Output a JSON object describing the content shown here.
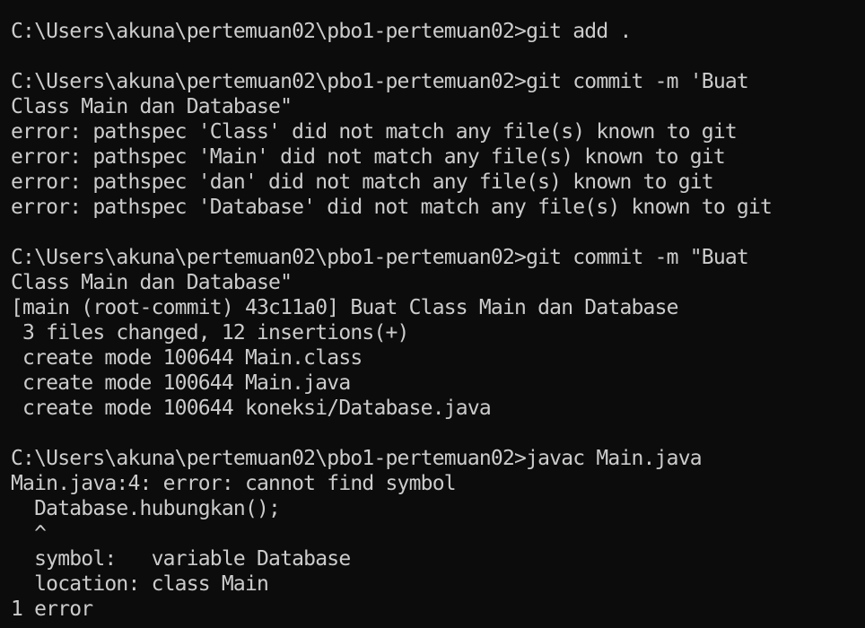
{
  "terminal": {
    "lines": [
      "C:\\Users\\akuna\\pertemuan02\\pbo1-pertemuan02>git add .",
      "",
      "C:\\Users\\akuna\\pertemuan02\\pbo1-pertemuan02>git commit -m 'Buat",
      "Class Main dan Database\"",
      "error: pathspec 'Class' did not match any file(s) known to git",
      "error: pathspec 'Main' did not match any file(s) known to git",
      "error: pathspec 'dan' did not match any file(s) known to git",
      "error: pathspec 'Database' did not match any file(s) known to git",
      "",
      "C:\\Users\\akuna\\pertemuan02\\pbo1-pertemuan02>git commit -m \"Buat",
      "Class Main dan Database\"",
      "[main (root-commit) 43c11a0] Buat Class Main dan Database",
      " 3 files changed, 12 insertions(+)",
      " create mode 100644 Main.class",
      " create mode 100644 Main.java",
      " create mode 100644 koneksi/Database.java",
      "",
      "C:\\Users\\akuna\\pertemuan02\\pbo1-pertemuan02>javac Main.java",
      "Main.java:4: error: cannot find symbol",
      "  Database.hubungkan();",
      "  ^",
      "  symbol:   variable Database",
      "  location: class Main",
      "1 error"
    ]
  },
  "colors": {
    "background": "#0c0c0c",
    "text": "#cccccc"
  }
}
